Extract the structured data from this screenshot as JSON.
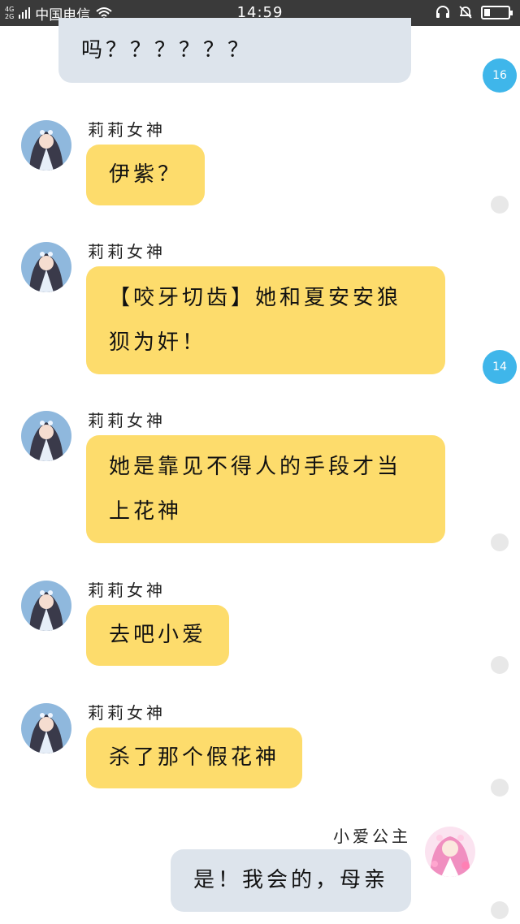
{
  "status_bar": {
    "network_top": "4G",
    "network_bottom": "2G",
    "carrier": "中国电信",
    "time": "14:59",
    "battery_level": 0.25
  },
  "messages": [
    {
      "sender": "",
      "text": "吗？？？？？？",
      "side": "right"
    },
    {
      "sender": "莉莉女神",
      "text": "伊紫？",
      "side": "left"
    },
    {
      "sender": "莉莉女神",
      "lines": [
        "【咬牙切齿】她和夏安安狼",
        "狈为奸！"
      ],
      "side": "left"
    },
    {
      "sender": "莉莉女神",
      "lines": [
        "她是靠见不得人的手段才当",
        "上花神"
      ],
      "side": "left"
    },
    {
      "sender": "莉莉女神",
      "text": "去吧小爱",
      "side": "left"
    },
    {
      "sender": "莉莉女神",
      "text": "杀了那个假花神",
      "side": "left"
    },
    {
      "sender": "小爱公主",
      "text": "是！我会的，母亲",
      "side": "right"
    }
  ],
  "badges": [
    "16",
    "14"
  ],
  "icons": {
    "wifi": "wifi-icon",
    "headset": "headset-icon",
    "mute": "bell-off-icon",
    "battery": "battery-icon"
  },
  "colors": {
    "status_bar": "#3a3a3a",
    "left_bubble": "#fddc6c",
    "right_bubble": "#dde4ec",
    "badge": "#3fb6ea"
  }
}
